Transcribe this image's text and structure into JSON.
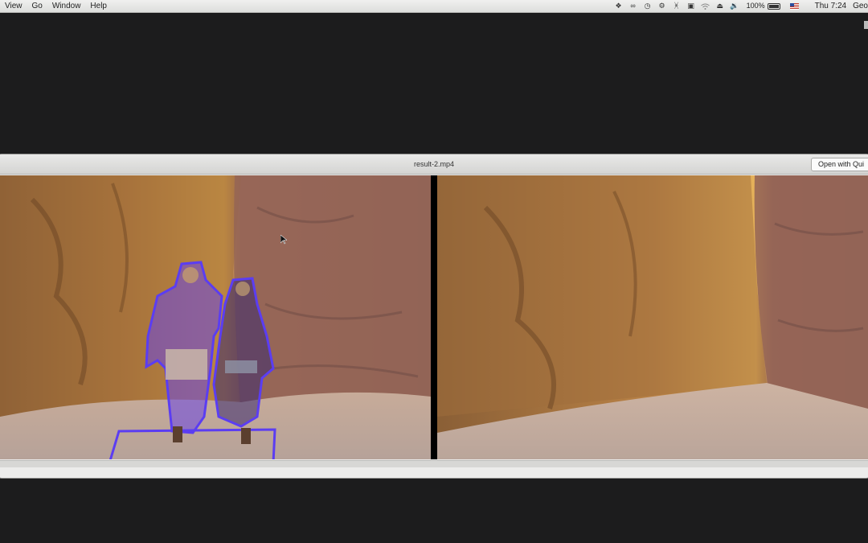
{
  "menubar": {
    "menus": [
      "View",
      "Go",
      "Window",
      "Help"
    ],
    "battery_text": "100%",
    "battery_level": 1.0,
    "clock": "Thu 7:24",
    "user": "Geo",
    "status_icons": [
      "dropbox-icon",
      "creative-cloud-icon",
      "time-machine-icon",
      "ink-icon",
      "bluetooth-icon",
      "display-icon",
      "wifi-icon",
      "eject-icon",
      "volume-icon"
    ]
  },
  "window": {
    "title": "result-2.mp4",
    "open_button_label": "Open with Qui"
  },
  "colors": {
    "mask_outline": "#5b3df2",
    "mask_fill": "#6a45e6"
  }
}
